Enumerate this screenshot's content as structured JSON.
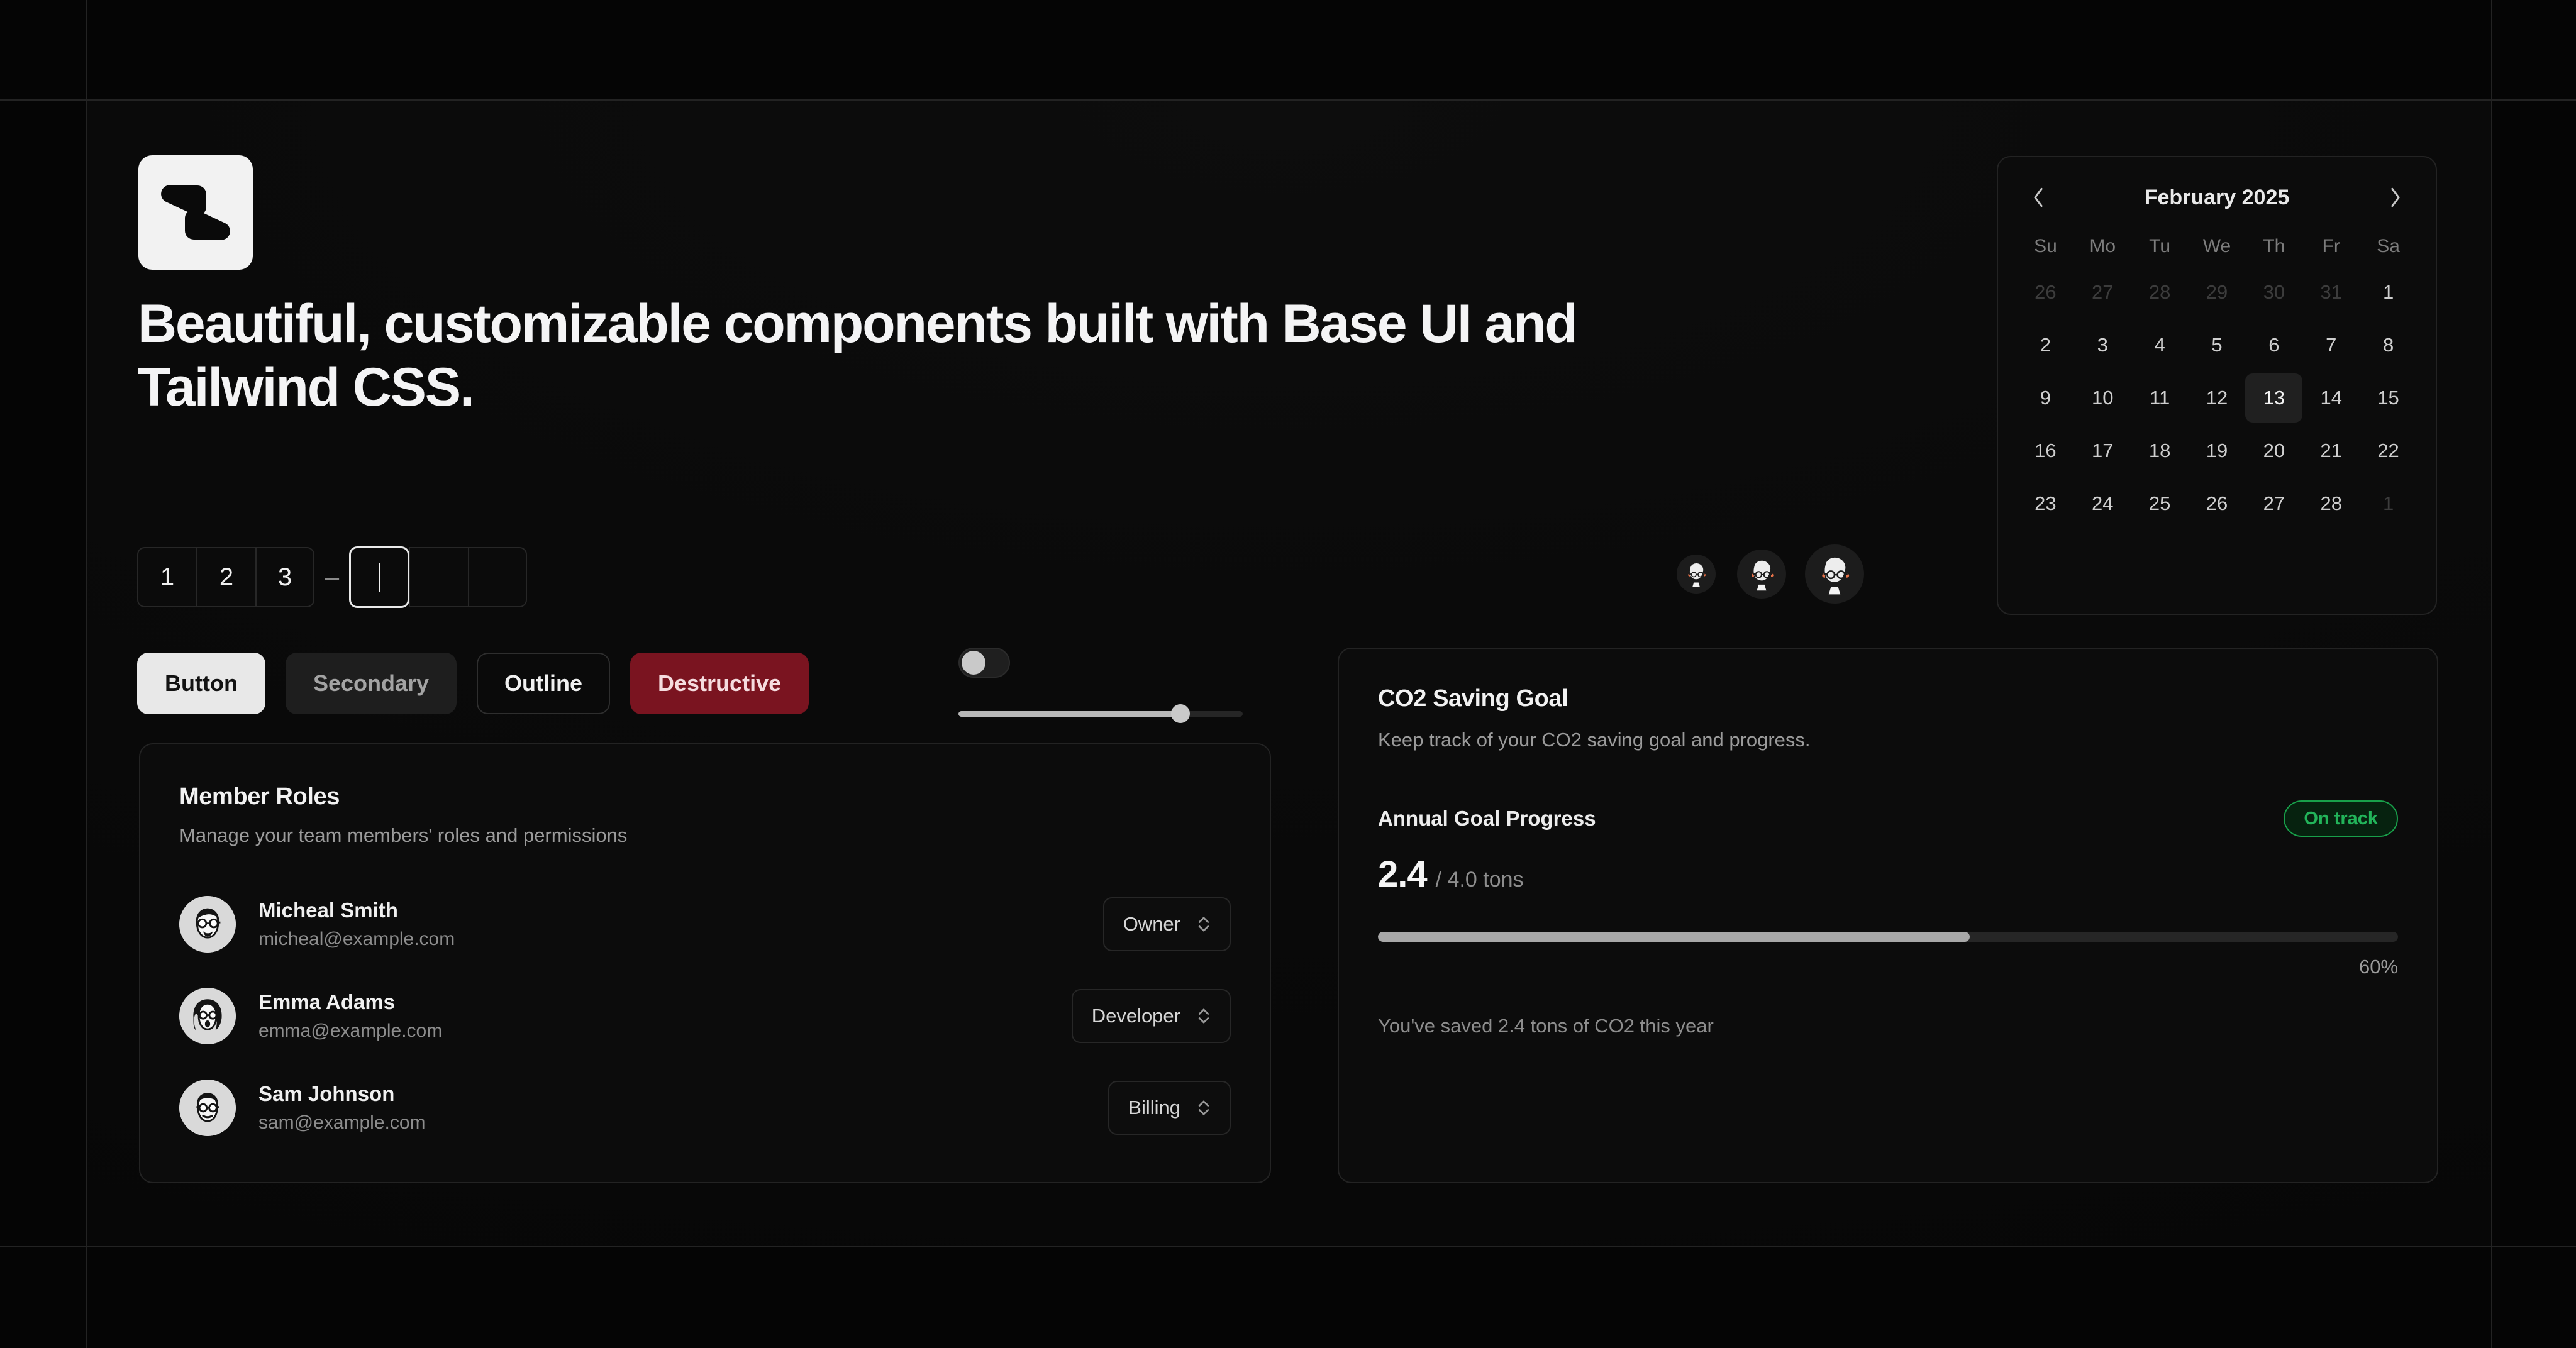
{
  "brand": {
    "logo_icon": "s-logo-mark"
  },
  "hero": {
    "headline": "Beautiful, customizable components built with Base UI and Tailwind CSS."
  },
  "otp": {
    "separator": "–",
    "slots": [
      "1",
      "2",
      "3",
      "",
      "",
      ""
    ],
    "focused_index": 3
  },
  "avatar_group": {
    "avatars": [
      {
        "name": "avatar-small",
        "size": "sm"
      },
      {
        "name": "avatar-medium",
        "size": "md"
      },
      {
        "name": "avatar-large",
        "size": "lg"
      }
    ]
  },
  "buttons": [
    {
      "label": "Button",
      "variant": "primary"
    },
    {
      "label": "Secondary",
      "variant": "secondary"
    },
    {
      "label": "Outline",
      "variant": "outline"
    },
    {
      "label": "Destructive",
      "variant": "destructive"
    }
  ],
  "controls": {
    "toggle": {
      "checked": false
    },
    "slider": {
      "value": 78,
      "min": 0,
      "max": 100
    }
  },
  "member_card": {
    "title": "Member Roles",
    "subtitle": "Manage your team members' roles and permissions",
    "members": [
      {
        "name": "Micheal Smith",
        "email": "micheal@example.com",
        "role": "Owner"
      },
      {
        "name": "Emma Adams",
        "email": "emma@example.com",
        "role": "Developer"
      },
      {
        "name": "Sam Johnson",
        "email": "sam@example.com",
        "role": "Billing"
      }
    ]
  },
  "co2_card": {
    "title": "CO2 Saving Goal",
    "subtitle": "Keep track of your CO2 saving goal and progress.",
    "progress_label": "Annual Goal Progress",
    "status_badge": "On track",
    "value": "2.4",
    "value_suffix": "/ 4.0 tons",
    "percent_label": "60%",
    "percent_value": 58,
    "footer": "You've saved 2.4 tons of CO2 this year",
    "accent_green": "#22b45a"
  },
  "calendar": {
    "title": "February 2025",
    "prev_icon": "chevron-left-icon",
    "next_icon": "chevron-right-icon",
    "day_names": [
      "Su",
      "Mo",
      "Tu",
      "We",
      "Th",
      "Fr",
      "Sa"
    ],
    "selected_day": "13",
    "weeks": [
      [
        {
          "d": "26",
          "muted": true
        },
        {
          "d": "27",
          "muted": true
        },
        {
          "d": "28",
          "muted": true
        },
        {
          "d": "29",
          "muted": true
        },
        {
          "d": "30",
          "muted": true
        },
        {
          "d": "31",
          "muted": true
        },
        {
          "d": "1",
          "muted": false
        }
      ],
      [
        {
          "d": "2"
        },
        {
          "d": "3"
        },
        {
          "d": "4"
        },
        {
          "d": "5"
        },
        {
          "d": "6"
        },
        {
          "d": "7"
        },
        {
          "d": "8"
        }
      ],
      [
        {
          "d": "9"
        },
        {
          "d": "10"
        },
        {
          "d": "11"
        },
        {
          "d": "12"
        },
        {
          "d": "13",
          "selected": true
        },
        {
          "d": "14"
        },
        {
          "d": "15"
        }
      ],
      [
        {
          "d": "16"
        },
        {
          "d": "17"
        },
        {
          "d": "18"
        },
        {
          "d": "19"
        },
        {
          "d": "20"
        },
        {
          "d": "21"
        },
        {
          "d": "22"
        }
      ],
      [
        {
          "d": "23"
        },
        {
          "d": "24"
        },
        {
          "d": "25"
        },
        {
          "d": "26"
        },
        {
          "d": "27"
        },
        {
          "d": "28"
        },
        {
          "d": "1",
          "muted": true
        }
      ]
    ]
  },
  "theme": {
    "background": "#050505",
    "card_bg": "#0c0c0c",
    "border": "#232323",
    "text_primary": "#f2f2f2",
    "text_muted": "#8d8d8d",
    "destructive": "#7a1420"
  }
}
